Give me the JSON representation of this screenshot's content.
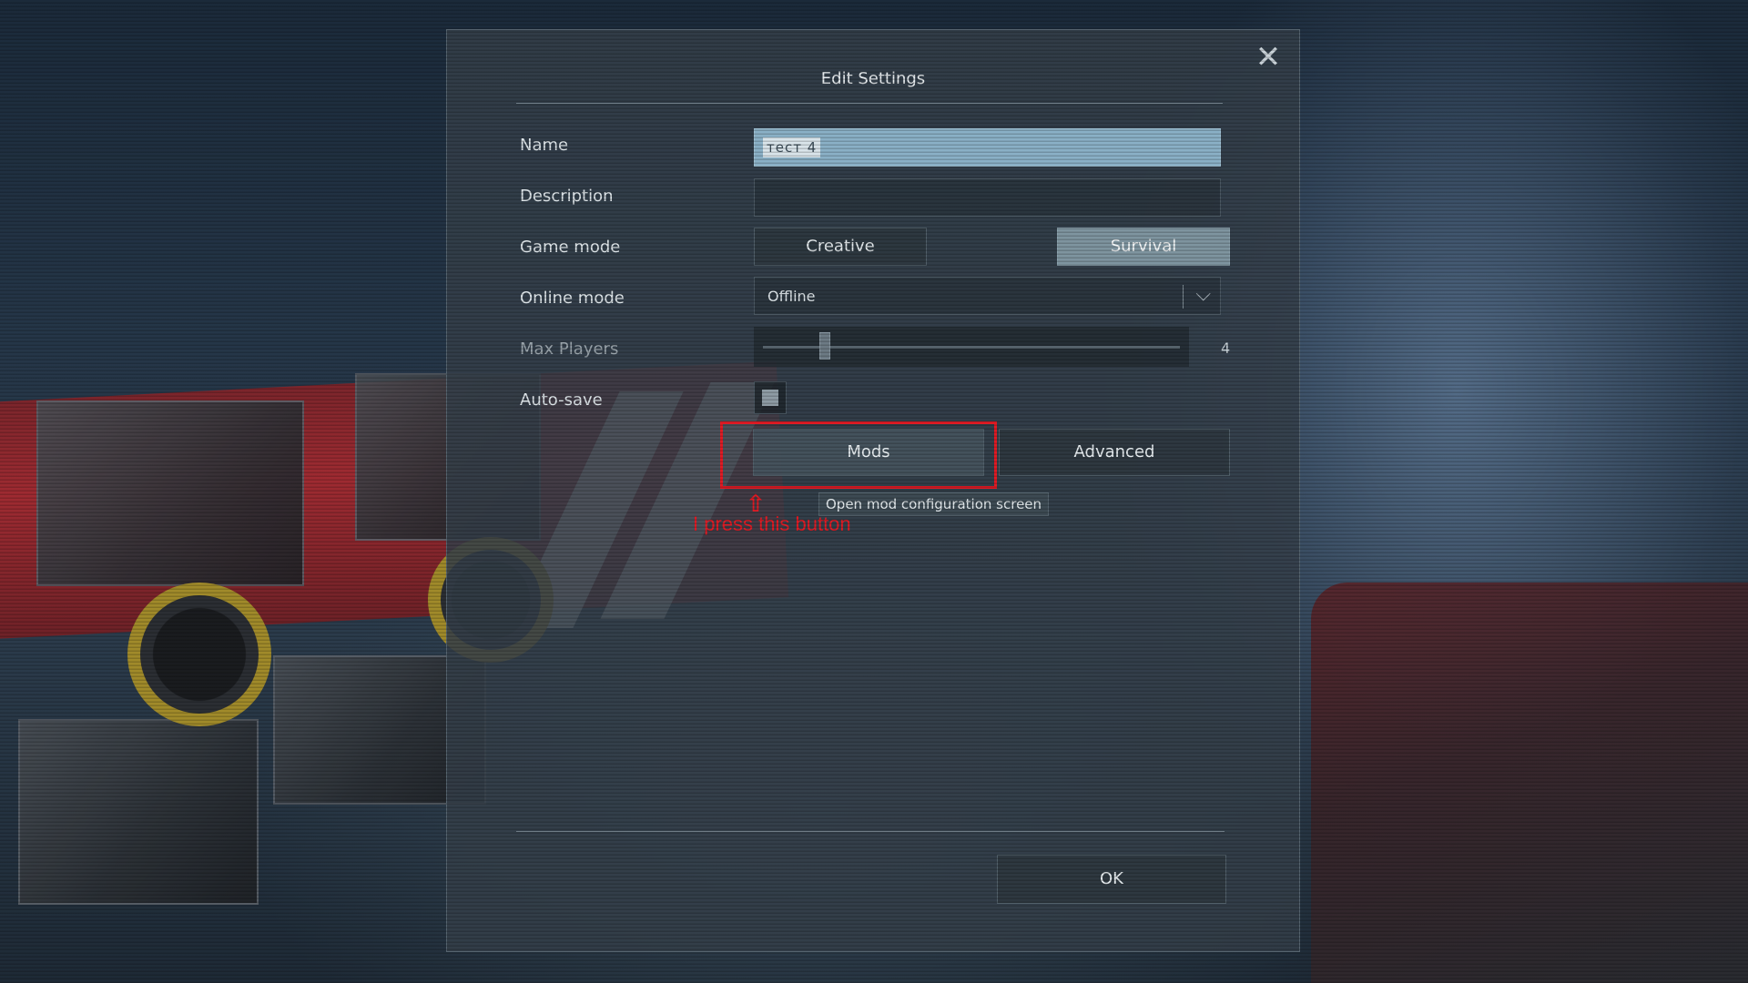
{
  "dialog": {
    "title": "Edit Settings",
    "close_icon": "close-icon"
  },
  "form": {
    "name_label": "Name",
    "name_value": "тест 4",
    "description_label": "Description",
    "description_value": "",
    "game_mode_label": "Game mode",
    "game_mode_options": [
      "Creative",
      "Survival"
    ],
    "game_mode_selected": "Survival",
    "online_mode_label": "Online mode",
    "online_mode_value": "Offline",
    "max_players_label": "Max Players",
    "max_players_value": "4",
    "max_players_fraction": 0.14,
    "auto_save_label": "Auto-save",
    "auto_save_checked": true
  },
  "buttons": {
    "mods": "Mods",
    "advanced": "Advanced",
    "ok": "OK"
  },
  "tooltip": {
    "text": "Open mod configuration screen"
  },
  "annotation": {
    "text": "I press this button",
    "color": "#e01b24"
  },
  "colors": {
    "accent_selected": "#7e949f",
    "name_field_highlight": "#8ab0c6"
  }
}
